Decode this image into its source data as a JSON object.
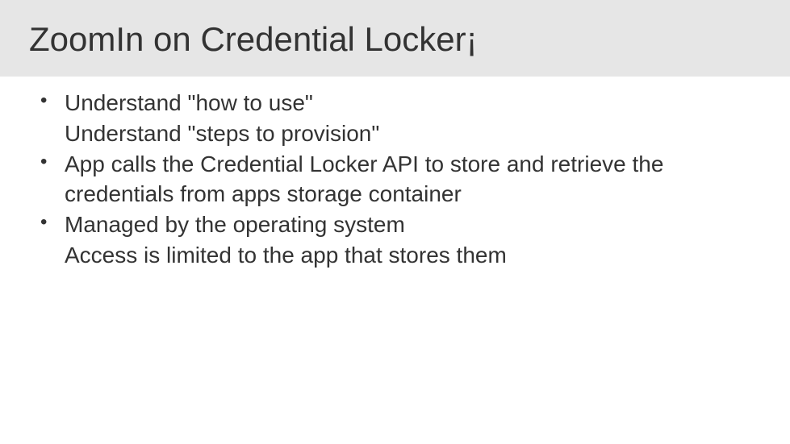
{
  "slide": {
    "title": "ZoomIn on Credential Locker¡",
    "bullets": [
      {
        "lines": [
          "Understand \"how to use\"",
          "Understand \"steps to provision\""
        ]
      },
      {
        "lines": [
          "App calls the Credential Locker API to store and retrieve the credentials from apps storage container"
        ]
      },
      {
        "lines": [
          "Managed by the operating system",
          "Access is limited to the app that stores them"
        ]
      }
    ]
  }
}
